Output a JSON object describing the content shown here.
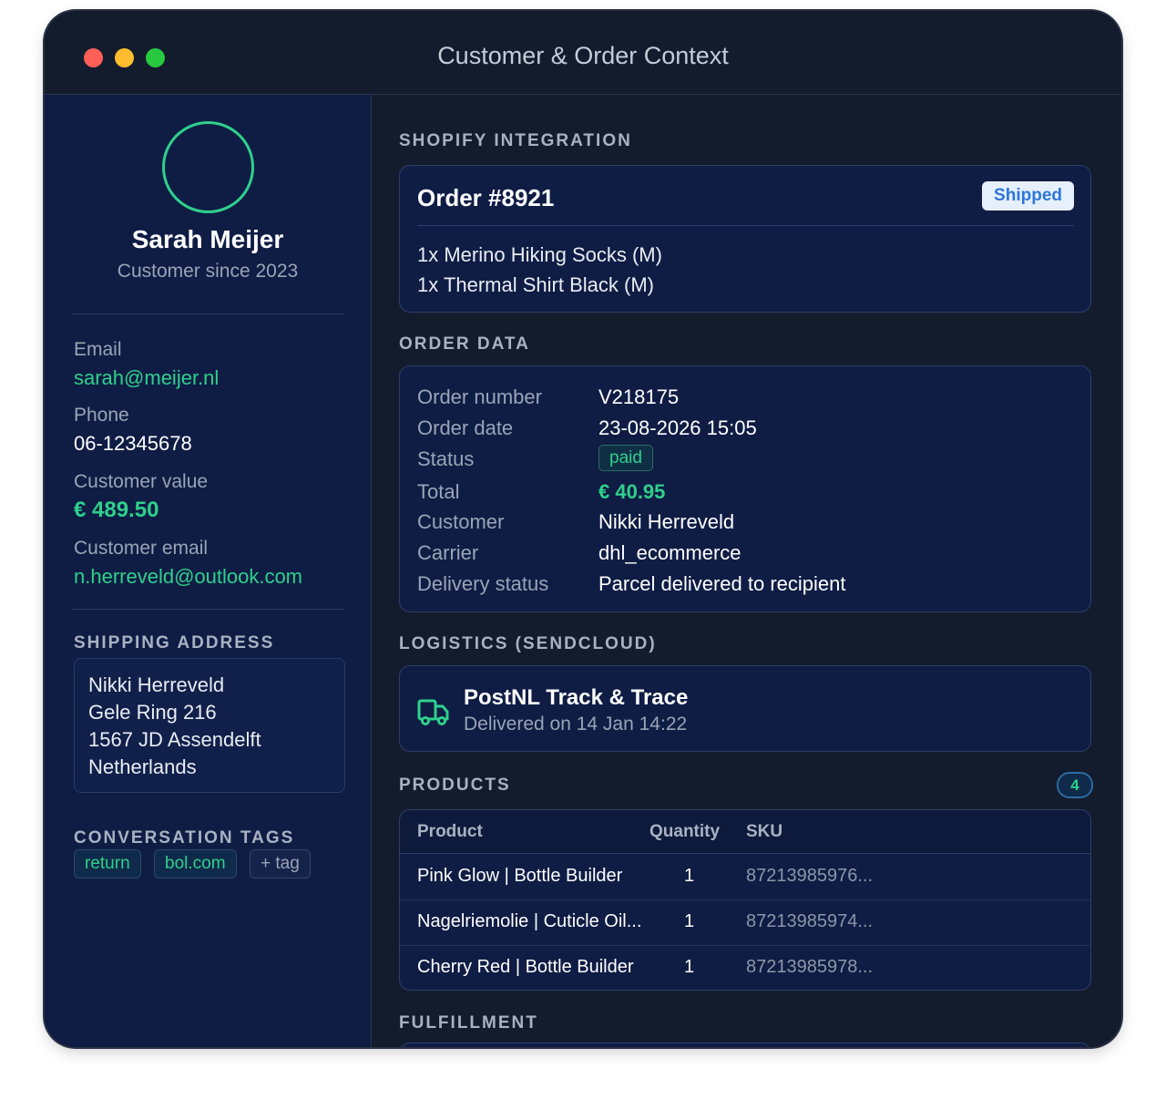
{
  "window": {
    "title": "Customer & Order Context"
  },
  "profile": {
    "name": "Sarah Meijer",
    "since": "Customer since 2023"
  },
  "contact": {
    "email_label": "Email",
    "email": "sarah@meijer.nl",
    "phone_label": "Phone",
    "phone": "06-12345678",
    "value_label": "Customer value",
    "value": "€ 489.50",
    "customer_email_label": "Customer email",
    "customer_email": "n.herreveld@outlook.com"
  },
  "shipping": {
    "heading": "SHIPPING ADDRESS",
    "lines": [
      "Nikki Herreveld",
      "Gele Ring 216",
      "1567 JD Assendelft",
      "Netherlands"
    ]
  },
  "tags": {
    "heading": "CONVERSATION TAGS",
    "items": [
      "return",
      "bol.com"
    ],
    "add_label": "+ tag"
  },
  "shopify": {
    "heading": "SHOPIFY INTEGRATION",
    "order_title": "Order #8921",
    "status_badge": "Shipped",
    "items": [
      "1x Merino Hiking Socks (M)",
      "1x Thermal Shirt Black (M)"
    ]
  },
  "order_data": {
    "heading": "ORDER DATA",
    "rows": [
      {
        "label": "Order number",
        "value": "V218175"
      },
      {
        "label": "Order date",
        "value": "23-08-2026 15:05"
      },
      {
        "label": "Status",
        "value": "paid"
      },
      {
        "label": "Total",
        "value": "€ 40.95"
      },
      {
        "label": "Customer",
        "value": "Nikki Herreveld"
      },
      {
        "label": "Carrier",
        "value": "dhl_ecommerce"
      },
      {
        "label": "Delivery status",
        "value": "Parcel delivered to recipient"
      }
    ]
  },
  "logistics": {
    "heading": "LOGISTICS (SENDCLOUD)",
    "title": "PostNL Track & Trace",
    "subtitle": "Delivered on 14 Jan 14:22",
    "icon": "truck-icon"
  },
  "products": {
    "heading": "PRODUCTS",
    "count": "4",
    "columns": [
      "Product",
      "Quantity",
      "SKU"
    ],
    "rows": [
      {
        "product": "Pink Glow | Bottle Builder",
        "quantity": "1",
        "sku": "87213985976..."
      },
      {
        "product": "Nagelriemolie | Cuticle Oil...",
        "quantity": "1",
        "sku": "87213985974..."
      },
      {
        "product": "Cherry Red | Bottle Builder",
        "quantity": "1",
        "sku": "87213985978..."
      }
    ]
  },
  "fulfillment": {
    "heading": "FULFILLMENT"
  },
  "colors": {
    "accent_green": "#2fd08b",
    "sidebar_bg": "#0f1d45",
    "window_bg": "#131c2d",
    "shipped_badge_text": "#2d77d8"
  }
}
